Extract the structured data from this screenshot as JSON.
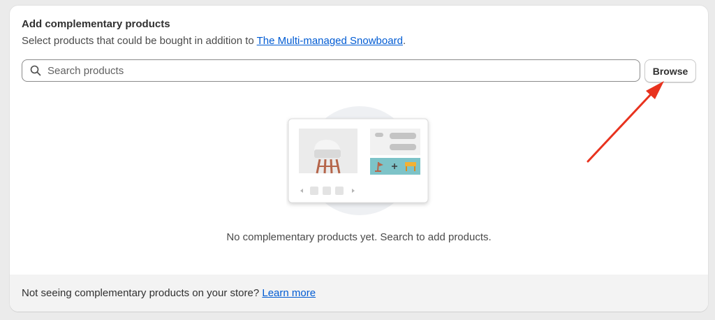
{
  "section": {
    "title": "Add complementary products",
    "subtitle_prefix": "Select products that could be bought in addition to",
    "product_link": "The Multi-managed Snowboard",
    "subtitle_suffix": "."
  },
  "search": {
    "placeholder": "Search products",
    "value": "",
    "icon": "search-icon"
  },
  "browse_button": {
    "label": "Browse"
  },
  "empty_state": {
    "message": "No complementary products yet. Search to add products."
  },
  "footer": {
    "text": "Not seeing complementary products on your store?",
    "link": "Learn more"
  },
  "colors": {
    "link": "#005bd3",
    "annotation_arrow": "#e8321e",
    "footer_bg": "#f3f3f3"
  }
}
